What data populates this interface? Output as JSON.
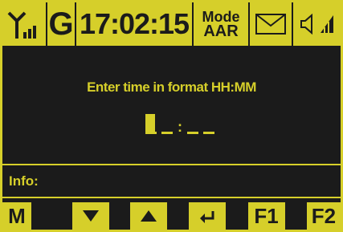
{
  "status": {
    "network": "G",
    "time": "17:02:15",
    "mode_label": "Mode",
    "mode_value": "AAR",
    "icons": [
      "antenna-signal-icon",
      "envelope-icon",
      "speaker-icon",
      "volume-level-icon"
    ]
  },
  "main": {
    "prompt": "Enter time in format HH:MM",
    "separator": ":"
  },
  "info": {
    "label": "Info:"
  },
  "softkeys": {
    "menu": "M",
    "f1": "F1",
    "f2": "F2"
  },
  "colors": {
    "accent": "#d6cf2a",
    "background": "#1b1b1b"
  }
}
